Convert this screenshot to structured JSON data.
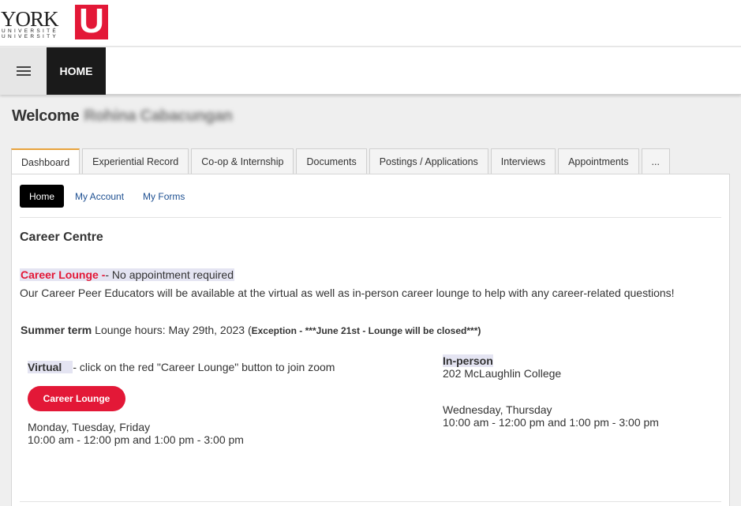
{
  "logo": {
    "wordmark": "YORK",
    "line1": "UNIVERSITÉ",
    "line2": "UNIVERSITY",
    "u_letter": "U",
    "brand_color": "#e31837"
  },
  "navbar": {
    "menu_icon": "hamburger-menu-icon",
    "home_label": "HOME"
  },
  "welcome": {
    "label": "Welcome",
    "name": "Rohina Cabacungan"
  },
  "tabs": [
    {
      "label": "Dashboard",
      "active": true
    },
    {
      "label": "Experiential Record"
    },
    {
      "label": "Co-op & Internship"
    },
    {
      "label": "Documents"
    },
    {
      "label": "Postings / Applications"
    },
    {
      "label": "Interviews"
    },
    {
      "label": "Appointments"
    },
    {
      "label": "..."
    }
  ],
  "subtabs": [
    {
      "label": "Home",
      "active": true
    },
    {
      "label": "My Account"
    },
    {
      "label": "My Forms"
    }
  ],
  "content": {
    "section_title": "Career Centre",
    "lounge_red": "Career Lounge -",
    "lounge_rest": "- No appointment required",
    "description": "Our Career Peer Educators will be available at the virtual as well as in-person career lounge to help with any career-related questions!",
    "term_bold": "Summer term",
    "term_text": " Lounge hours: May 29th, 2023 (",
    "term_exception": "Exception - ***June 21st - Lounge will be closed***)",
    "virtual_label": "Virtual",
    "virtual_text": "- click on the red \"Career Lounge\" button to join zoom",
    "lounge_button": "Career Lounge",
    "virtual_days": "Monday, Tuesday, Friday",
    "virtual_hours": "10:00 am - 12:00 pm and 1:00 pm - 3:00 pm",
    "inperson_label": "In-person",
    "inperson_location": "202 McLaughlin College",
    "inperson_days": "Wednesday, Thursday",
    "inperson_hours": "10:00 am - 12:00 pm and 1:00 pm - 3:00 pm"
  },
  "colors": {
    "accent_red": "#e31837",
    "active_tab_border": "#e8a33c",
    "link_blue": "#1d4f91"
  }
}
